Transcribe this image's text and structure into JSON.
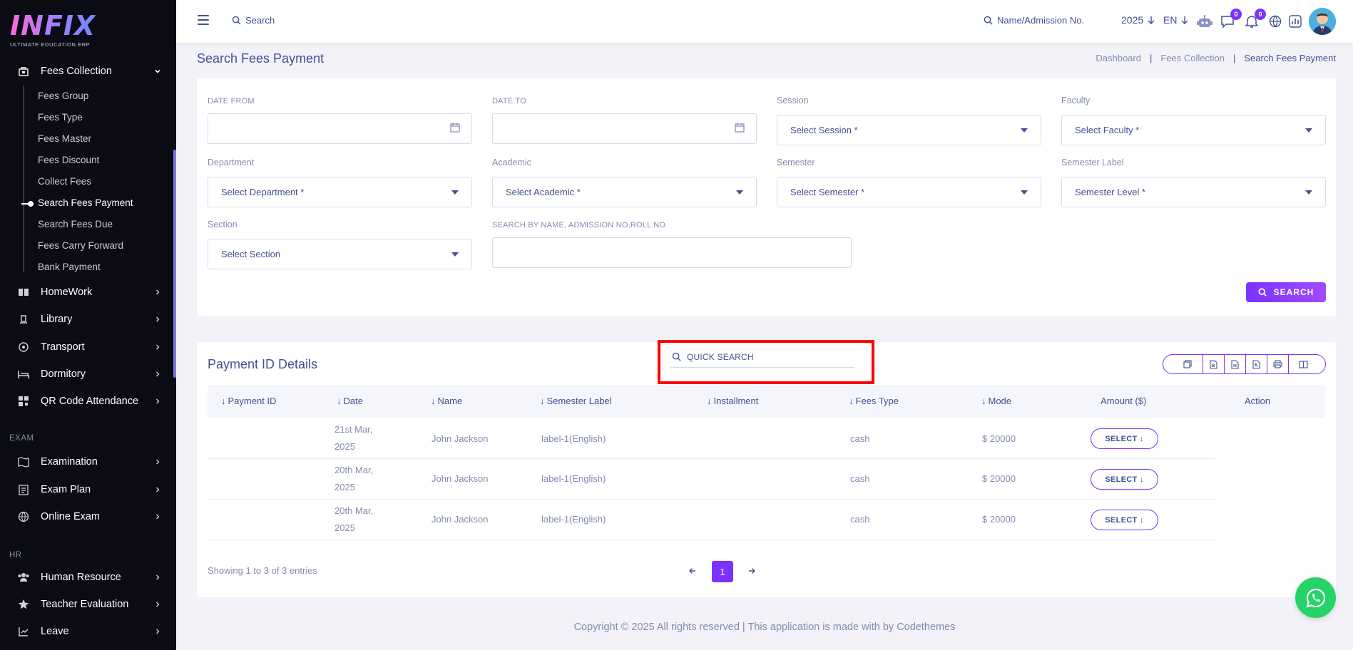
{
  "brand": {
    "logo_text": "INFIX",
    "logo_sub": "ULTIMATE EDUCATION ERP"
  },
  "sidebar": {
    "fees_collection": "Fees Collection",
    "sub_items": [
      "Fees Group",
      "Fees Type",
      "Fees Master",
      "Fees Discount",
      "Collect Fees",
      "Search Fees Payment",
      "Search Fees Due",
      "Fees Carry Forward",
      "Bank Payment"
    ],
    "active_sub": "Search Fees Payment",
    "items": [
      "HomeWork",
      "Library",
      "Transport",
      "Dormitory",
      "QR Code Attendance"
    ],
    "exam_section": "EXAM",
    "exam_items": [
      "Examination",
      "Exam Plan",
      "Online Exam"
    ],
    "hr_section": "HR",
    "hr_items": [
      "Human Resource",
      "Teacher Evaluation",
      "Leave"
    ]
  },
  "header": {
    "search_label": "Search",
    "name_search": "Name/Admission No.",
    "year": "2025",
    "lang": "EN",
    "messages_count": "0",
    "notifications_count": "0"
  },
  "page": {
    "title": "Search Fees Payment",
    "breadcrumb": [
      "Dashboard",
      "Fees Collection",
      "Search Fees Payment"
    ]
  },
  "filters": {
    "date_from_label": "DATE FROM",
    "date_to_label": "DATE TO",
    "session_label": "Session",
    "session_value": "Select Session *",
    "faculty_label": "Faculty",
    "faculty_value": "Select Faculty *",
    "department_label": "Department",
    "department_value": "Select Department *",
    "academic_label": "Academic",
    "academic_value": "Select Academic *",
    "semester_label": "Semester",
    "semester_value": "Select Semester *",
    "semester_level_label": "Semester Label",
    "semester_level_value": "Semester Level *",
    "section_label": "Section",
    "section_value": "Select Section",
    "search_by_label": "SEARCH BY NAME, ADMISSION NO,ROLL NO",
    "search_button": "SEARCH"
  },
  "table": {
    "title": "Payment ID Details",
    "quick_search": "QUICK SEARCH",
    "columns": [
      "Payment ID",
      "Date",
      "Name",
      "Semester Label",
      "Installment",
      "Fees Type",
      "Mode",
      "Amount ($)",
      "Action"
    ],
    "rows": [
      {
        "date_line1": "21st Mar,",
        "date_line2": "2025",
        "name": "John Jackson",
        "semester_label": "label-1(English)",
        "mode": "cash",
        "amount": "$ 20000",
        "action": "SELECT"
      },
      {
        "date_line1": "20th Mar,",
        "date_line2": "2025",
        "name": "John Jackson",
        "semester_label": "label-1(English)",
        "mode": "cash",
        "amount": "$ 20000",
        "action": "SELECT"
      },
      {
        "date_line1": "20th Mar,",
        "date_line2": "2025",
        "name": "John Jackson",
        "semester_label": "label-1(English)",
        "mode": "cash",
        "amount": "$ 20000",
        "action": "SELECT"
      }
    ],
    "showing": "Showing 1 to 3 of 3 entries",
    "page": "1"
  },
  "footer": {
    "text": "Copyright © 2025 All rights reserved | This application is made with by Codethemes"
  },
  "colors": {
    "accent": "#7c32ff",
    "text": "#415094",
    "muted": "#828bb2",
    "sidebar_bg": "#0b0b14",
    "highlight": "#ff0000",
    "whatsapp": "#25d366"
  },
  "icons": [
    "menu-icon",
    "search-icon",
    "robot-icon",
    "chat-icon",
    "bell-icon",
    "globe-icon",
    "chart-icon",
    "calendar-icon",
    "copy-icon",
    "excel-icon",
    "csv-icon",
    "pdf-icon",
    "print-icon",
    "columns-icon",
    "whatsapp-icon"
  ]
}
